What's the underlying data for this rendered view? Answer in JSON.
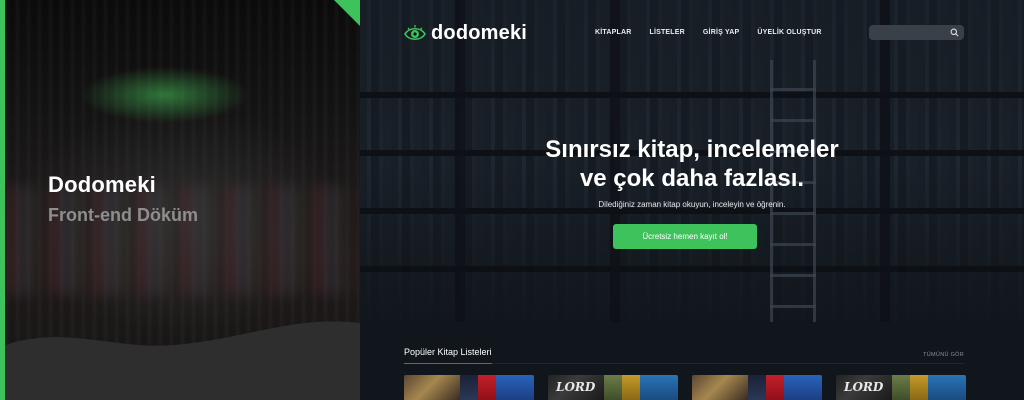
{
  "promo": {
    "title": "Dodomeki",
    "subtitle": "Front-end Döküm",
    "accent_color": "#3ec25b"
  },
  "site": {
    "logo_text": "dodomeki",
    "logo_icon": "eye-icon",
    "nav": [
      {
        "label": "KİTAPLAR"
      },
      {
        "label": "LİSTELER"
      },
      {
        "label": "GİRİŞ YAP"
      },
      {
        "label": "ÜYELİK OLUŞTUR"
      }
    ],
    "search": {
      "placeholder": "",
      "icon": "search-icon"
    },
    "hero": {
      "title_line1": "Sınırsız kitap, incelemeler",
      "title_line2": "ve çok daha fazlası.",
      "subtitle": "Dilediğiniz zaman kitap okuyun, inceleyin ve öğrenin.",
      "cta_label": "Ücretsiz hemen kayıt ol!"
    },
    "popular": {
      "title": "Popüler Kitap Listeleri",
      "see_all": "TÜMÜNÜ GÖR",
      "card_cover_text": "LORD"
    }
  }
}
